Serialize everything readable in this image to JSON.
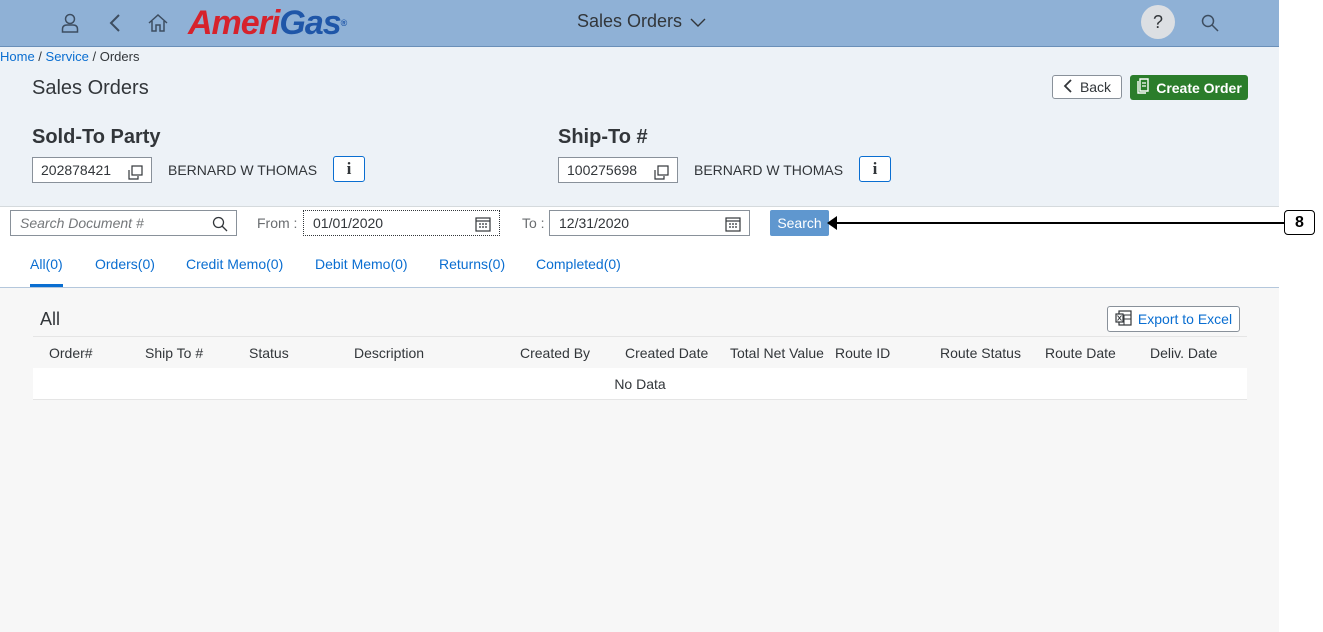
{
  "shell": {
    "logo_main": "AmeriGas",
    "logo_reg": "®",
    "title": "Sales Orders",
    "help_label": "?",
    "icons": [
      "user-icon",
      "back-arrow-icon",
      "home-icon",
      "chevron-down-icon",
      "search-icon"
    ]
  },
  "breadcrumb": {
    "home": "Home",
    "sep1": " / ",
    "service": "Service",
    "sep2": " / ",
    "current": "Orders"
  },
  "page": {
    "title": "Sales Orders",
    "back_label": "Back",
    "create_label": "Create Order"
  },
  "sold_to": {
    "label": "Sold-To Party",
    "number": "202878421",
    "name": "BERNARD W THOMAS",
    "info_label": "i"
  },
  "ship_to": {
    "label": "Ship-To #",
    "number": "100275698",
    "name": "BERNARD W THOMAS",
    "info_label": "i"
  },
  "filter": {
    "search_placeholder": "Search Document #",
    "from_label": "From :",
    "from_value": "01/01/2020",
    "to_label": "To :",
    "to_value": "12/31/2020",
    "search_button": "Search"
  },
  "tabs": [
    {
      "label": "All(0)",
      "selected": true
    },
    {
      "label": "Orders(0)"
    },
    {
      "label": "Credit Memo(0)"
    },
    {
      "label": "Debit Memo(0)"
    },
    {
      "label": "Returns(0)"
    },
    {
      "label": "Completed(0)"
    }
  ],
  "table": {
    "title": "All",
    "export_label": "Export to Excel",
    "columns": [
      "Order#",
      "Ship To #",
      "Status",
      "Description",
      "Created By",
      "Created Date",
      "Total Net Value",
      "Route ID",
      "Route Status",
      "Route Date",
      "Deliv. Date"
    ],
    "empty_text": "No Data"
  },
  "callout": {
    "number": "8"
  },
  "colors": {
    "shell": "#8fb1d6",
    "accent": "#0a6ed1",
    "create": "#2b7d2b",
    "search_button": "#5f97cf",
    "logo_red": "#d6222c",
    "logo_blue": "#1f56a8"
  }
}
